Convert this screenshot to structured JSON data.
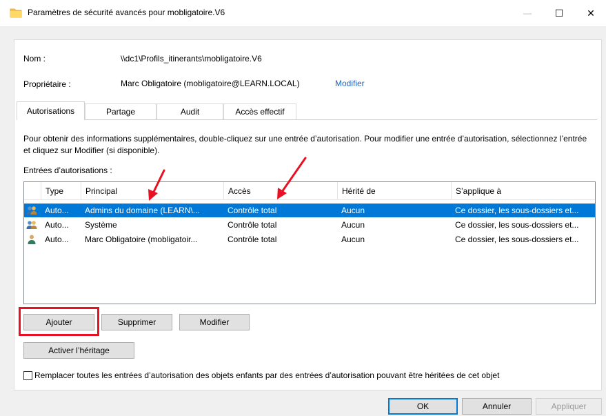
{
  "window": {
    "title": "Paramètres de sécurité avancés pour mobligatoire.V6",
    "controls": {
      "minimize": "—",
      "maximize": "☐",
      "close": "✕"
    }
  },
  "info": {
    "name_label": "Nom :",
    "name_value": "\\\\dc1\\Profils_itinerants\\mobligatoire.V6",
    "owner_label": "Propriétaire :",
    "owner_value": "Marc Obligatoire (mobligatoire@LEARN.LOCAL)",
    "owner_link": "Modifier"
  },
  "tabs": [
    {
      "label": "Autorisations",
      "active": true
    },
    {
      "label": "Partage",
      "active": false
    },
    {
      "label": "Audit",
      "active": false
    },
    {
      "label": "Accès effectif",
      "active": false
    }
  ],
  "description": "Pour obtenir des informations supplémentaires, double-cliquez sur une entrée d’autorisation. Pour modifier une entrée d’autorisation, sélectionnez l’entrée et cliquez sur Modifier (si disponible).",
  "entries_label": "Entrées d’autorisations :",
  "table": {
    "columns": [
      "Type",
      "Principal",
      "Accès",
      "Hérité de",
      "S’applique à"
    ],
    "rows": [
      {
        "icon": "group-users-icon",
        "type": "Auto...",
        "principal": "Admins du domaine (LEARN\\...",
        "access": "Contrôle total",
        "inherited": "Aucun",
        "applies": "Ce dossier, les sous-dossiers et...",
        "selected": true
      },
      {
        "icon": "group-users-icon",
        "type": "Auto...",
        "principal": "Système",
        "access": "Contrôle total",
        "inherited": "Aucun",
        "applies": "Ce dossier, les sous-dossiers et...",
        "selected": false
      },
      {
        "icon": "user-icon",
        "type": "Auto...",
        "principal": "Marc Obligatoire (mobligatoir...",
        "access": "Contrôle total",
        "inherited": "Aucun",
        "applies": "Ce dossier, les sous-dossiers et...",
        "selected": false
      }
    ]
  },
  "buttons": {
    "add": "Ajouter",
    "remove": "Supprimer",
    "edit": "Modifier",
    "enable_inheritance": "Activer l’héritage"
  },
  "replace_checkbox": {
    "label": "Remplacer toutes les entrées d’autorisation des objets enfants par des entrées d’autorisation pouvant être héritées de cet objet",
    "checked": false
  },
  "footer": {
    "ok": "OK",
    "cancel": "Annuler",
    "apply": "Appliquer"
  },
  "colors": {
    "selection": "#0078d7",
    "annotation": "#e81123",
    "link": "#1a62c9"
  }
}
